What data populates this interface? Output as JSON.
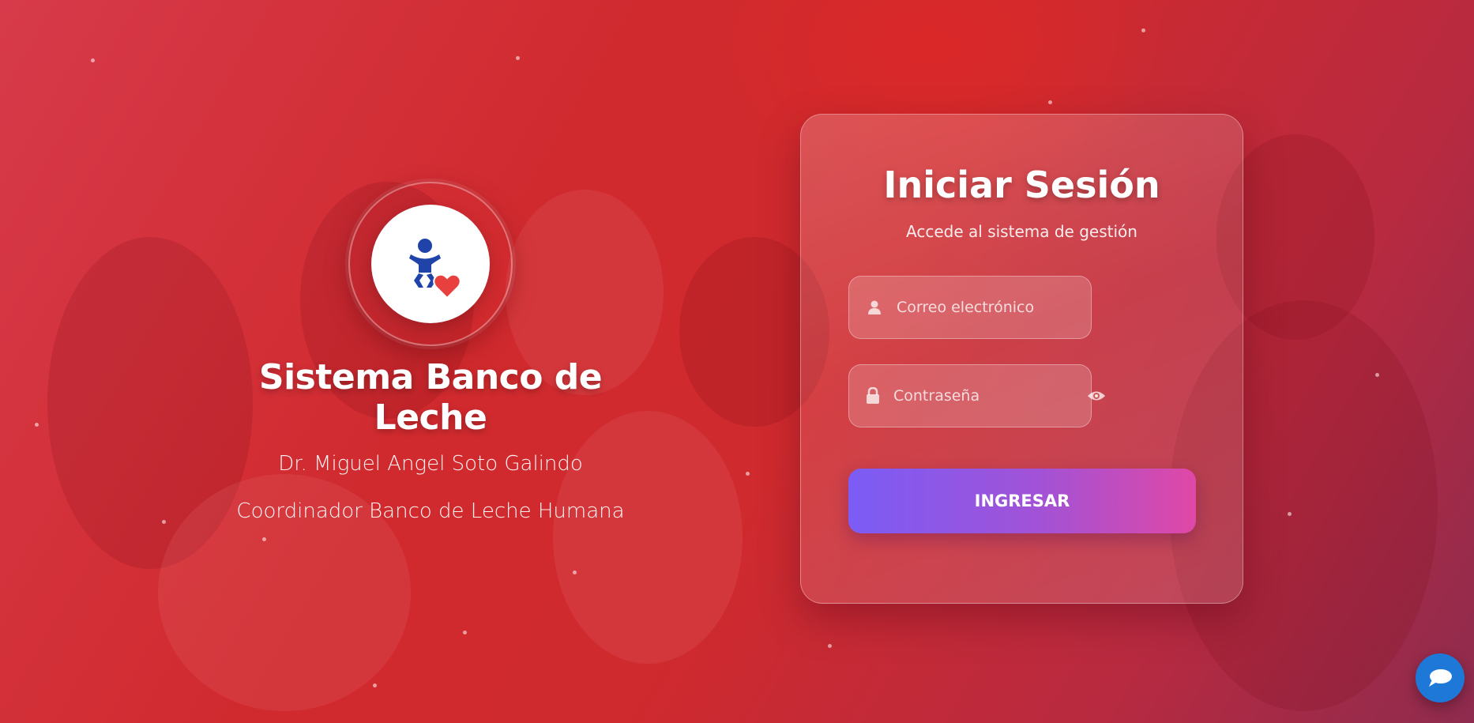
{
  "brand": {
    "title": "Sistema Banco de Leche",
    "name": "Dr. Miguel Angel Soto Galindo",
    "role": "Coordinador Banco de Leche Humana",
    "logo_icon": "baby-heart-icon"
  },
  "login": {
    "title": "Iniciar Sesión",
    "subtitle": "Accede al sistema de gestión",
    "email_placeholder": "Correo electrónico",
    "email_icon": "user-icon",
    "password_placeholder": "Contraseña",
    "password_icon": "lock-icon",
    "toggle_icon": "eye-icon",
    "submit_label": "INGRESAR"
  },
  "chat": {
    "icon": "chat-bubble-icon"
  },
  "colors": {
    "background": "#cf2a2e",
    "button_start": "#7b5cf5",
    "button_end": "#e048a6",
    "logo_figure": "#1f43a8",
    "logo_heart": "#e8403e",
    "chat_button": "#1e78d8"
  }
}
